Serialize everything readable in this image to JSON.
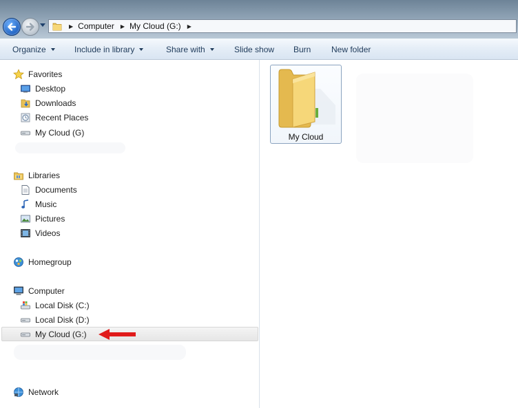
{
  "address_bar": {
    "crumbs": [
      "Computer",
      "My Cloud (G:)"
    ]
  },
  "toolbar": {
    "organize": "Organize",
    "include_in_library": "Include in library",
    "share_with": "Share with",
    "slide_show": "Slide show",
    "burn": "Burn",
    "new_folder": "New folder"
  },
  "nav": {
    "favorites": {
      "label": "Favorites",
      "items": [
        "Desktop",
        "Downloads",
        "Recent Places",
        "My Cloud (G)"
      ]
    },
    "libraries": {
      "label": "Libraries",
      "items": [
        "Documents",
        "Music",
        "Pictures",
        "Videos"
      ]
    },
    "homegroup": "Homegroup",
    "computer": {
      "label": "Computer",
      "items": [
        "Local Disk (C:)",
        "Local Disk (D:)",
        "My Cloud (G:)"
      ],
      "selected": "My Cloud (G:)"
    },
    "network": "Network"
  },
  "content": {
    "items": [
      {
        "label": "My Cloud",
        "icon": "folder-icon"
      }
    ]
  },
  "colors": {
    "selection_arrow": "#e01b1b",
    "folder_yellow": "#f2cf6b"
  }
}
